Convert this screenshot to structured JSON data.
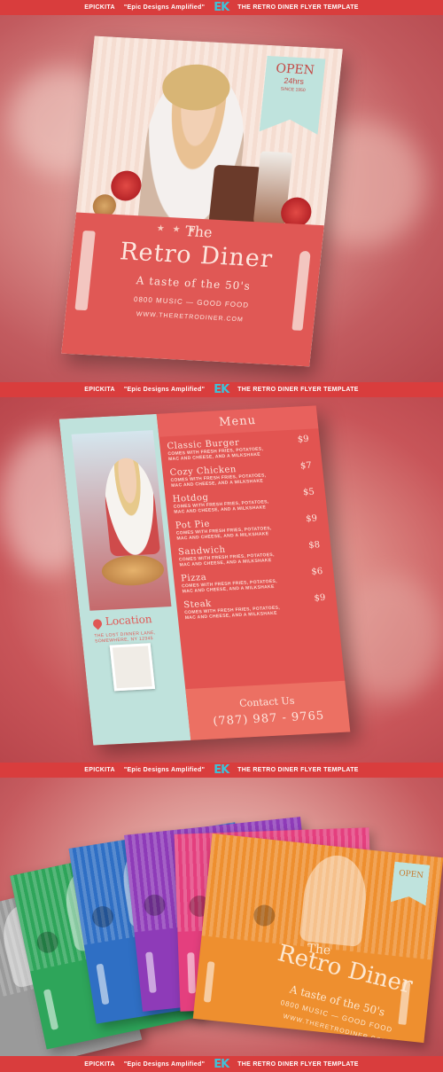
{
  "banner": {
    "brand": "EPICKITA",
    "tagline": "\"Epic Designs Amplified\"",
    "logo": "EK",
    "template_name": "THE RETRO DINER FLYER TEMPLATE",
    "logo_color": "#3fc1d8",
    "bar_color": "#d93d3d"
  },
  "flyer_front": {
    "badge_open": "OPEN",
    "badge_hours": "24hrs",
    "badge_small": "SINCE 1950",
    "stars": "★ ★ ★",
    "the": "The",
    "title": "Retro Diner",
    "tagline": "A taste of the 50's",
    "line": "0800 MUSIC — GOOD FOOD",
    "url": "WWW.THERETRODINER.COM"
  },
  "flyer_back": {
    "menu_title": "Menu",
    "items": [
      {
        "name": "Classic Burger",
        "price": "$9",
        "desc": "COMES WITH FRESH FRIES, POTATOES, MAC AND CHEESE, AND A MILKSHAKE"
      },
      {
        "name": "Cozy Chicken",
        "price": "$7",
        "desc": "COMES WITH FRESH FRIES, POTATOES, MAC AND CHEESE, AND A MILKSHAKE"
      },
      {
        "name": "Hotdog",
        "price": "$5",
        "desc": "COMES WITH FRESH FRIES, POTATOES, MAC AND CHEESE, AND A MILKSHAKE"
      },
      {
        "name": "Pot Pie",
        "price": "$9",
        "desc": "COMES WITH FRESH FRIES, POTATOES, MAC AND CHEESE, AND A MILKSHAKE"
      },
      {
        "name": "Sandwich",
        "price": "$8",
        "desc": "COMES WITH FRESH FRIES, POTATOES, MAC AND CHEESE, AND A MILKSHAKE"
      },
      {
        "name": "Pizza",
        "price": "$6",
        "desc": "COMES WITH FRESH FRIES, POTATOES, MAC AND CHEESE, AND A MILKSHAKE"
      },
      {
        "name": "Steak",
        "price": "$9",
        "desc": "COMES WITH FRESH FRIES, POTATOES, MAC AND CHEESE, AND A MILKSHAKE"
      }
    ],
    "location_title": "Location",
    "address": "THE LOST DINNER LANE, SOMEWHERE, NY 12345",
    "contact_title": "Contact Us",
    "phone": "(787) 987 - 9765"
  },
  "flyer_orange": {
    "badge": "OPEN",
    "the": "The",
    "title": "Retro Diner",
    "tagline": "A taste of the 50's",
    "line": "0800 MUSIC — GOOD FOOD",
    "url": "WWW.THERETRODINER.COM"
  },
  "variant_colors": [
    "#9a9a9a",
    "#2ea55a",
    "#2f6fc4",
    "#8e3bb8",
    "#e43f7e",
    "#ee8f2f"
  ]
}
